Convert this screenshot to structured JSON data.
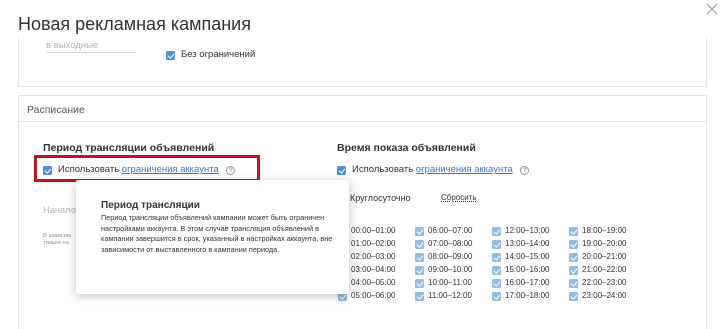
{
  "modal": {
    "title": "Новая рекламная кампания",
    "close_icon": "close-icon"
  },
  "top_card": {
    "weekend_label": "в выходные",
    "no_limit_label": "Без ограничений"
  },
  "schedule": {
    "section_title": "Расписание",
    "period": {
      "title": "Период трансляции объявлений",
      "use_label": "Использовать",
      "account_limits_link": "ограничения аккаунта",
      "faded_heading": "Начало",
      "faded_note_line1": "В зависим",
      "faded_note_line2": "только на"
    },
    "time": {
      "title": "Время показа объявлений",
      "use_label": "Использовать",
      "account_limits_link": "ограничения аккаунта",
      "around_clock_label": "Круглосуточно",
      "reset_label": "Сбросить",
      "slots": [
        [
          "00:00–01:00",
          "06:00–07:00",
          "12:00–13:00",
          "18:00–19:00"
        ],
        [
          "01:00–02:00",
          "07:00–08:00",
          "13:00–14:00",
          "19:00–20:00"
        ],
        [
          "02:00–03:00",
          "08:00–09:00",
          "14:00–15:00",
          "20:00–21:00"
        ],
        [
          "03:00–04:00",
          "09:00–10:00",
          "15:00–16:00",
          "21:00–22:00"
        ],
        [
          "04:00–05:00",
          "10:00–11:00",
          "16:00–17:00",
          "22:00–23:00"
        ],
        [
          "05:00–06:00",
          "11:00–12:00",
          "17:00–18:00",
          "23:00–24:00"
        ]
      ]
    }
  },
  "tooltip": {
    "title": "Период трансляции",
    "body": "Период трансляции объявлений кампании может быть ограничен настройками аккаунта. В этом случае трансляция объявлений в кампании завершится в срок, указанный в настройках аккаунта, вне зависимости от выставленного в кампании периода."
  },
  "colors": {
    "accent": "#4f91d9",
    "link": "#3c78c2",
    "highlight": "#c0161d"
  }
}
